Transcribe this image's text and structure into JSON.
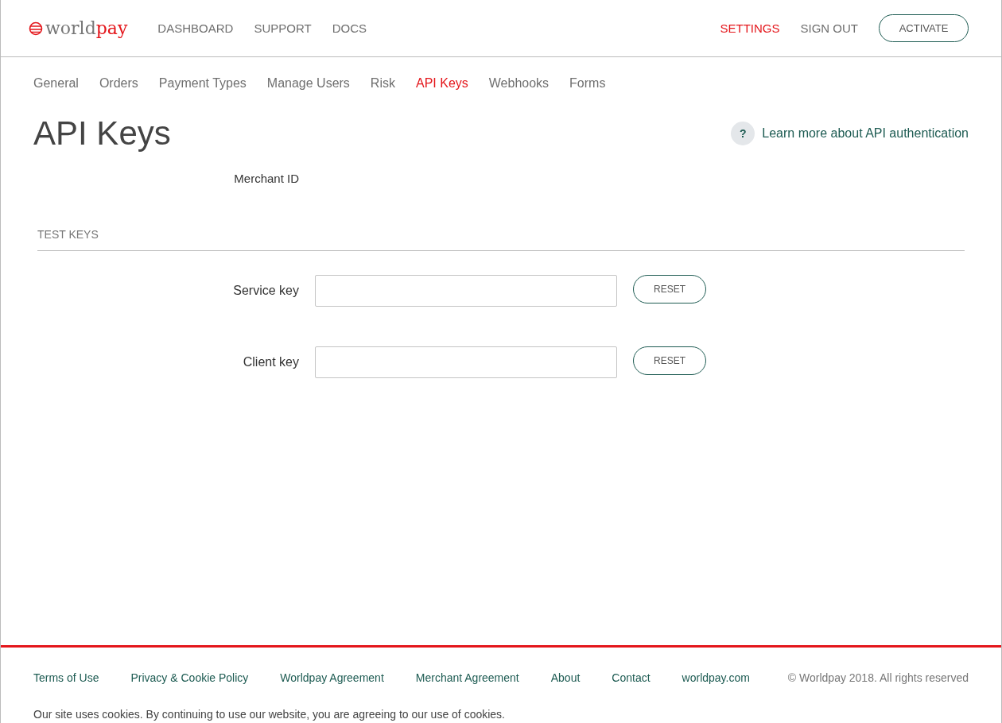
{
  "logo": {
    "part_1": "world",
    "part_2": "pay"
  },
  "top_nav": [
    {
      "label": "DASHBOARD",
      "selected": false
    },
    {
      "label": "SUPPORT",
      "selected": false
    },
    {
      "label": "DOCS",
      "selected": false
    }
  ],
  "account_nav": [
    {
      "label": "SETTINGS",
      "selected": true
    },
    {
      "label": "SIGN OUT",
      "selected": false
    }
  ],
  "activate_button": "ACTIVATE",
  "tabs": [
    {
      "label": "General",
      "selected": false
    },
    {
      "label": "Orders",
      "selected": false
    },
    {
      "label": "Payment Types",
      "selected": false
    },
    {
      "label": "Manage Users",
      "selected": false
    },
    {
      "label": "Risk",
      "selected": false
    },
    {
      "label": "API Keys",
      "selected": true
    },
    {
      "label": "Webhooks",
      "selected": false
    },
    {
      "label": "Forms",
      "selected": false
    }
  ],
  "page_title": "API Keys",
  "help_link": {
    "icon": "?",
    "label": "Learn more about API authentication"
  },
  "merchant_id_label": "Merchant ID",
  "section_title": "TEST KEYS",
  "keys": [
    {
      "label": "Service key",
      "button": "RESET"
    },
    {
      "label": "Client key",
      "button": "RESET"
    }
  ],
  "footer_links": [
    "Terms of Use",
    "Privacy & Cookie Policy",
    "Worldpay Agreement",
    "Merchant Agreement",
    "About",
    "Contact",
    "worldpay.com"
  ],
  "copyright": "© Worldpay 2018. All rights reserved",
  "cookie_notice": "Our site uses cookies. By continuing to use our website, you are agreeing to our use of cookies."
}
